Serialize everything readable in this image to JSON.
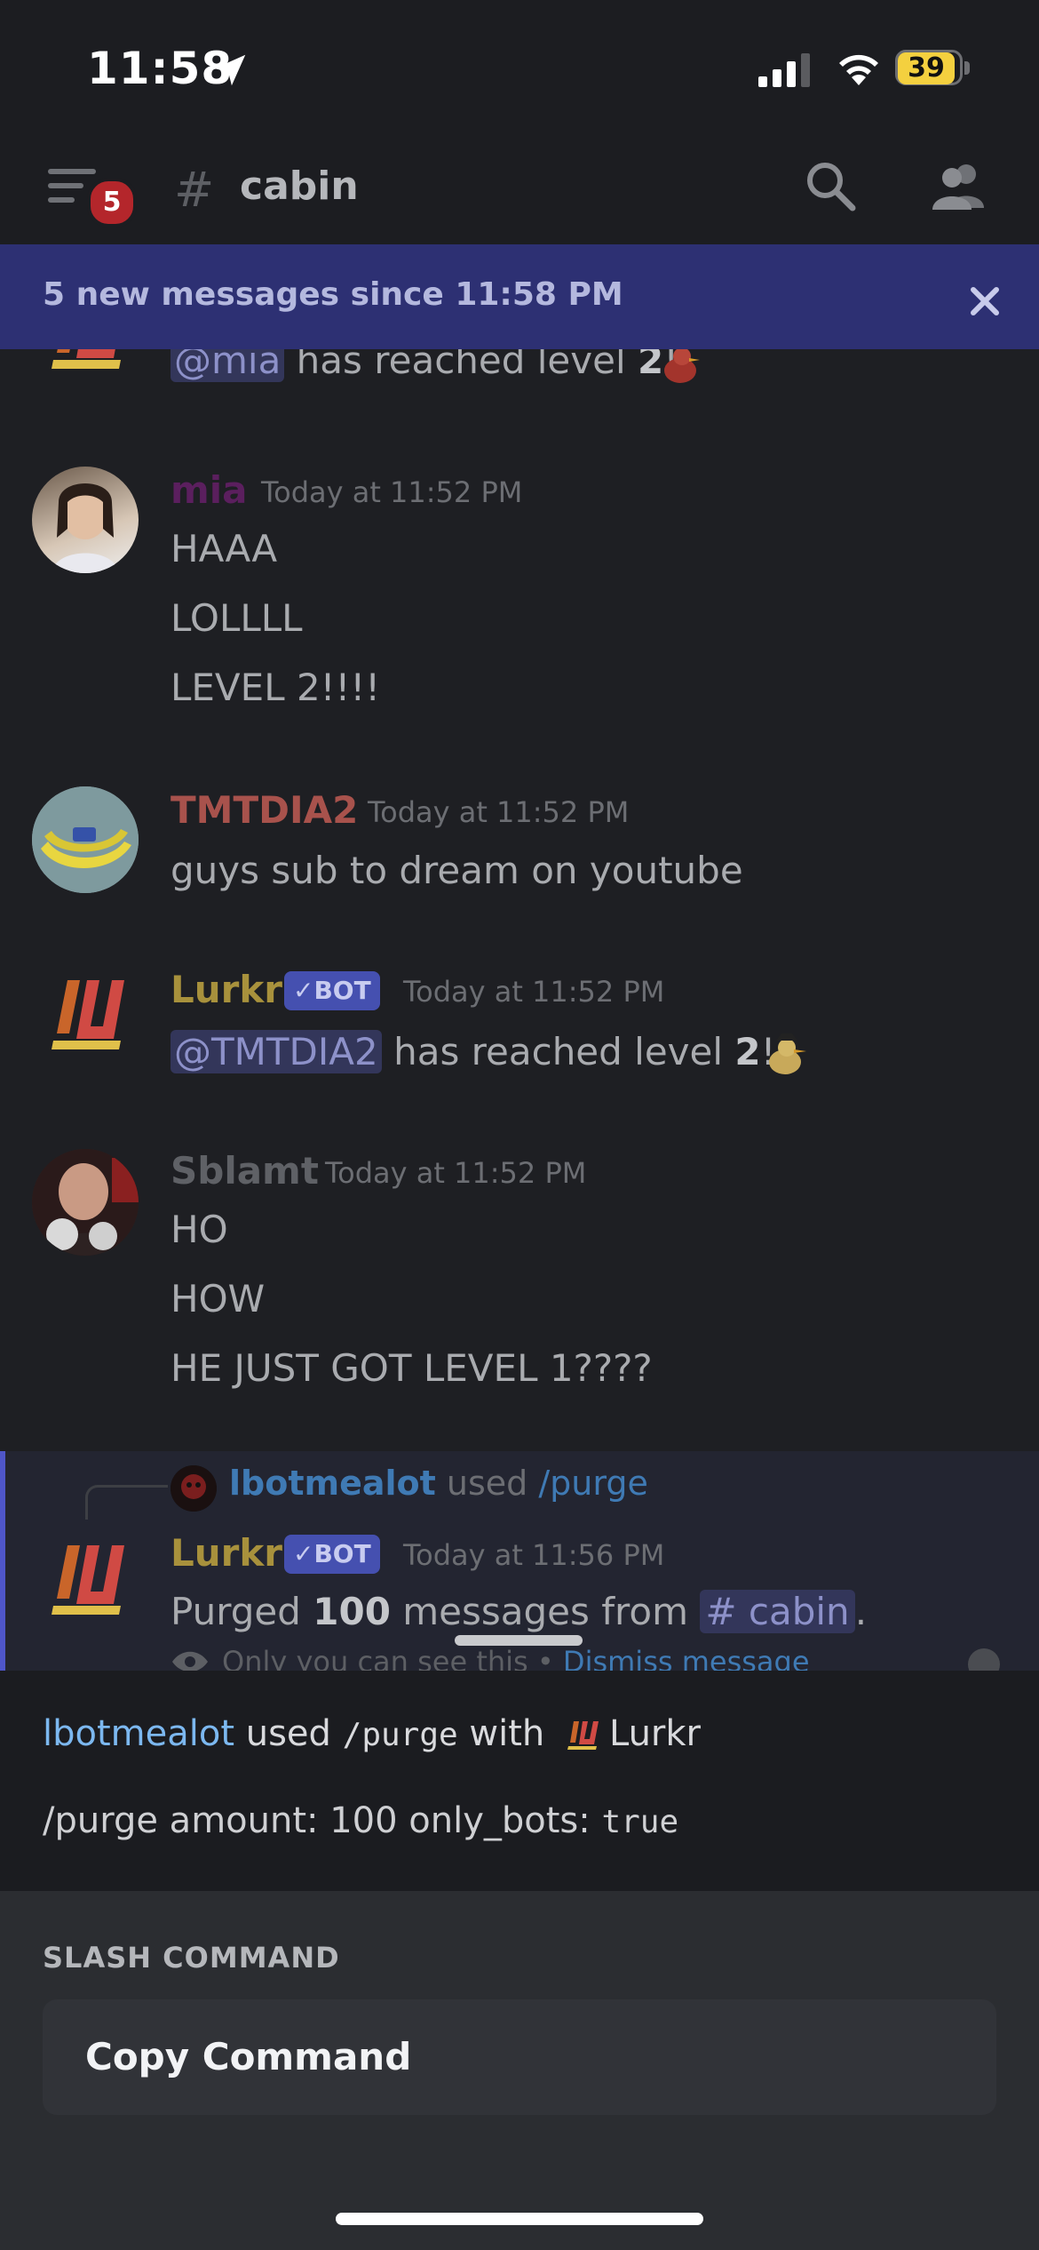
{
  "status_bar": {
    "time": "11:58",
    "battery": "39"
  },
  "header": {
    "badge_count": "5",
    "hash": "#",
    "channel": "cabin"
  },
  "banner": {
    "text": "5 new messages since 11:58 PM"
  },
  "messages": {
    "level_mia": {
      "mention": "@mia",
      "text_before": " has reached level ",
      "level": "2",
      "text_after": "!"
    },
    "mia": {
      "username": "mia",
      "time": "Today at 11:52 PM",
      "lines": [
        "HAAA",
        "LOLLLL",
        "LEVEL 2!!!!"
      ]
    },
    "tmtdia2": {
      "username": "TMTDIA2",
      "time": "Today at 11:52 PM",
      "lines": [
        "guys sub to dream on youtube"
      ]
    },
    "lurkr_level": {
      "username": "Lurkr",
      "bot_tag": "✓BOT",
      "time": "Today at 11:52 PM",
      "mention": "@TMTDIA2",
      "text_before": " has reached level ",
      "level": "2",
      "text_after": "!"
    },
    "sblamt": {
      "username": "Sblamt",
      "time": "Today at 11:52 PM",
      "lines": [
        "HO",
        "HOW",
        "HE JUST GOT LEVEL 1????"
      ]
    },
    "purge": {
      "reply_user": "lbotmealot",
      "reply_used": " used ",
      "reply_command": "/purge",
      "username": "Lurkr",
      "bot_tag": "✓BOT",
      "time": "Today at 11:56 PM",
      "text_before": "Purged ",
      "count": "100",
      "text_mid": " messages from ",
      "channel_mention": "# cabin",
      "text_after": ".",
      "ephemeral": "Only you can see this • ",
      "dismiss": "Dismiss message"
    }
  },
  "sheet": {
    "used_user": "lbotmealot",
    "used_text": " used ",
    "used_command": "/purge",
    "used_with": " with ",
    "bot_name": "Lurkr",
    "args": "/purge amount: 100 only_bots: ",
    "args_value": "true",
    "section_title": "SLASH COMMAND",
    "copy_label": "Copy Command"
  },
  "colors": {
    "mia": "#5b1f5e",
    "tmtdia2": "#a8524c",
    "lurkr": "#a8913c",
    "sblamt": "#5f6166",
    "accent": "#4f56c9",
    "user_link": "#7cb8f0"
  }
}
